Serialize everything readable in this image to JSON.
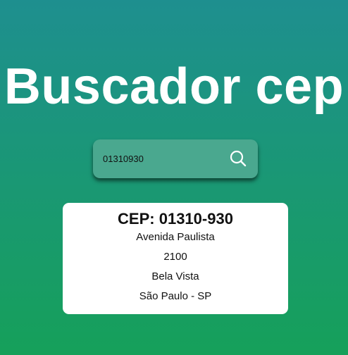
{
  "page": {
    "title": "Buscador cep"
  },
  "search": {
    "value": "01310930",
    "icon": "search-icon"
  },
  "result": {
    "cep_label": "CEP: 01310-930",
    "street": "Avenida Paulista",
    "number": "2100",
    "neighborhood": "Bela Vista",
    "city_state": "São Paulo - SP"
  },
  "colors": {
    "gradient_top": "#1e8f8f",
    "gradient_bottom": "#16a05a",
    "search_bg": "#4aa88f",
    "card_bg": "#ffffff"
  }
}
